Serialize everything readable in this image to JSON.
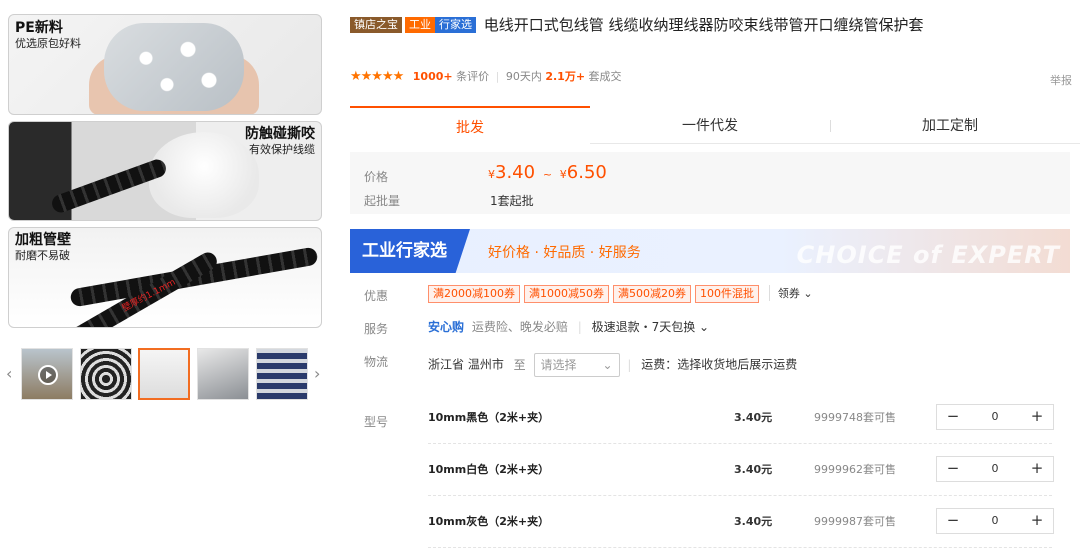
{
  "gallery": {
    "image1": {
      "title": "PE新料",
      "subtitle": "优选原包好料"
    },
    "image2": {
      "title": "防触碰撕咬",
      "subtitle": "有效保护线缆"
    },
    "image3": {
      "title": "加粗管壁",
      "subtitle": "耐磨不易破",
      "mark": "壁厚约1.1mm"
    },
    "prev_arrow": "‹",
    "next_arrow": "›"
  },
  "product": {
    "badges": [
      "镇店之宝",
      "工业",
      "行家选"
    ],
    "title": "电线开口式包线管 线缆收纳理线器防咬束线带管开口缠绕管保护套",
    "stars": "★★★★★",
    "review_count": "1000+",
    "review_label": "条评价",
    "sold_prefix": "90天内",
    "sold_count": "2.1万+",
    "sold_label": "套成交",
    "report": "举报"
  },
  "tabs": [
    "批发",
    "一件代发",
    "加工定制"
  ],
  "pricing": {
    "price_label": "价格",
    "currency": "¥",
    "price_low": "3.40",
    "price_sep": "~",
    "price_high": "6.50",
    "moq_label": "起批量",
    "moq_value": "1套起批"
  },
  "expert_banner": {
    "logo": "工业行家选",
    "slogan": "好价格 · 好品质 · 好服务",
    "bg_text": "CHOICE of EXPERT"
  },
  "offers": {
    "label": "优惠",
    "coupons": [
      "满2000减100券",
      "满1000减50券",
      "满500减20券",
      "100件混批"
    ],
    "get_coupon": "领券 ⌄"
  },
  "service": {
    "label": "服务",
    "brand": "安心购",
    "items": "运费险、晚发必赔",
    "extra": "极速退款・7天包换 ⌄"
  },
  "logistics": {
    "label": "物流",
    "origin": "浙江省 温州市",
    "to": "至",
    "select_placeholder": "请选择",
    "fee": "运费：选择收货地后展示运费"
  },
  "sku": {
    "label": "型号",
    "rows": [
      {
        "name": "10mm黑色（2米+夹）",
        "price": "3.40元",
        "stock": "9999748套可售",
        "qty": "0"
      },
      {
        "name": "10mm白色（2米+夹）",
        "price": "3.40元",
        "stock": "9999962套可售",
        "qty": "0"
      },
      {
        "name": "10mm灰色（2米+夹）",
        "price": "3.40元",
        "stock": "9999987套可售",
        "qty": "0"
      }
    ],
    "minus": "−",
    "plus": "+"
  },
  "colors": {
    "accent": "#ff5000",
    "expert_blue": "#2962d9",
    "service_blue": "#2a6fd6"
  }
}
